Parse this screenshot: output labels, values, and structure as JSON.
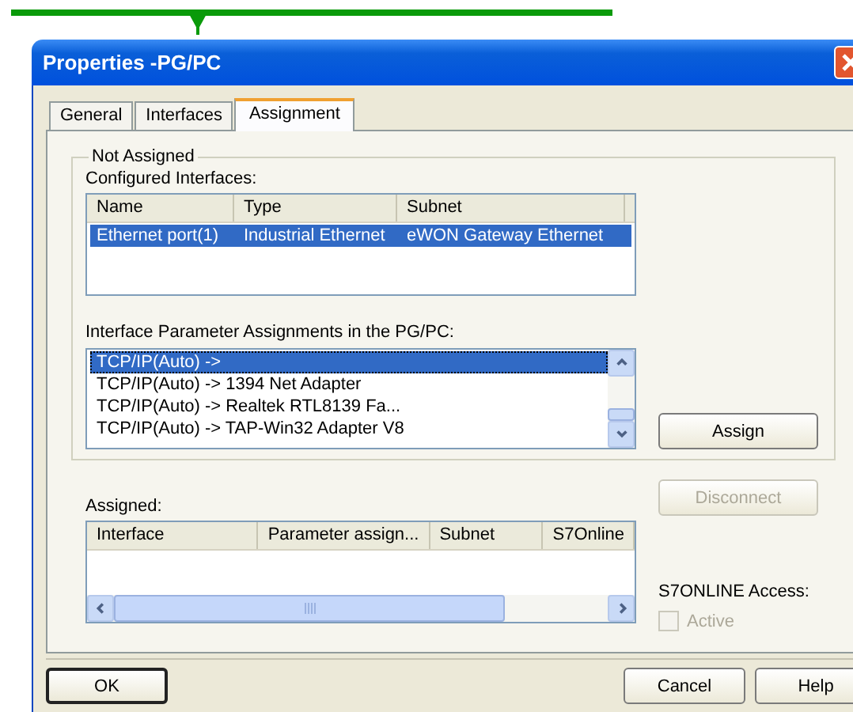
{
  "window": {
    "title": "Properties -PG/PC"
  },
  "tabs": [
    {
      "label": "General",
      "selected": false
    },
    {
      "label": "Interfaces",
      "selected": false
    },
    {
      "label": "Assignment",
      "selected": true
    }
  ],
  "not_assigned": {
    "title": "Not Assigned",
    "configured_label": "Configured Interfaces:",
    "configured_columns": [
      "Name",
      "Type",
      "Subnet"
    ],
    "configured_rows": [
      {
        "cells": [
          "Ethernet port(1)",
          "Industrial Ethernet",
          "eWON Gateway Ethernet"
        ],
        "selected": true
      }
    ],
    "parameter_label": "Interface Parameter Assignments in the PG/PC:",
    "parameter_items": [
      {
        "label": "TCP/IP(Auto) ->",
        "selected": true
      },
      {
        "label": "TCP/IP(Auto) -> 1394 Net Adapter",
        "selected": false
      },
      {
        "label": "TCP/IP(Auto) -> Realtek RTL8139 Fa...",
        "selected": false
      },
      {
        "label": "TCP/IP(Auto) -> TAP-Win32 Adapter V8",
        "selected": false
      }
    ],
    "assign_button": {
      "label": "Assign",
      "disabled": false
    }
  },
  "assigned": {
    "label": "Assigned:",
    "columns": [
      "Interface",
      "Parameter assign...",
      "Subnet",
      "S7Online"
    ],
    "disconnect_button": {
      "label": "Disconnect",
      "disabled": true
    },
    "access_label": "S7ONLINE Access:",
    "active_checkbox": {
      "label": "Active",
      "checked": false,
      "disabled": true
    }
  },
  "buttons": [
    {
      "label": "OK",
      "default": true,
      "kind": "left"
    },
    {
      "label": "Cancel",
      "default": false,
      "kind": "right"
    },
    {
      "label": "Help",
      "default": false,
      "kind": "right"
    }
  ]
}
